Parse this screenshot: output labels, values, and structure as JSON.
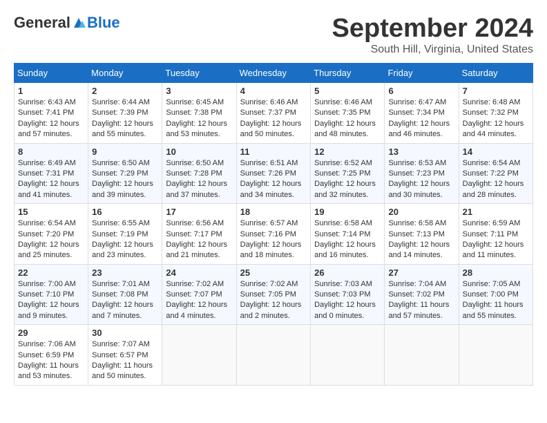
{
  "header": {
    "logo_general": "General",
    "logo_blue": "Blue",
    "month": "September 2024",
    "location": "South Hill, Virginia, United States"
  },
  "days_of_week": [
    "Sunday",
    "Monday",
    "Tuesday",
    "Wednesday",
    "Thursday",
    "Friday",
    "Saturday"
  ],
  "weeks": [
    [
      {
        "day": "1",
        "sunrise": "6:43 AM",
        "sunset": "7:41 PM",
        "daylight": "12 hours and 57 minutes."
      },
      {
        "day": "2",
        "sunrise": "6:44 AM",
        "sunset": "7:39 PM",
        "daylight": "12 hours and 55 minutes."
      },
      {
        "day": "3",
        "sunrise": "6:45 AM",
        "sunset": "7:38 PM",
        "daylight": "12 hours and 53 minutes."
      },
      {
        "day": "4",
        "sunrise": "6:46 AM",
        "sunset": "7:37 PM",
        "daylight": "12 hours and 50 minutes."
      },
      {
        "day": "5",
        "sunrise": "6:46 AM",
        "sunset": "7:35 PM",
        "daylight": "12 hours and 48 minutes."
      },
      {
        "day": "6",
        "sunrise": "6:47 AM",
        "sunset": "7:34 PM",
        "daylight": "12 hours and 46 minutes."
      },
      {
        "day": "7",
        "sunrise": "6:48 AM",
        "sunset": "7:32 PM",
        "daylight": "12 hours and 44 minutes."
      }
    ],
    [
      {
        "day": "8",
        "sunrise": "6:49 AM",
        "sunset": "7:31 PM",
        "daylight": "12 hours and 41 minutes."
      },
      {
        "day": "9",
        "sunrise": "6:50 AM",
        "sunset": "7:29 PM",
        "daylight": "12 hours and 39 minutes."
      },
      {
        "day": "10",
        "sunrise": "6:50 AM",
        "sunset": "7:28 PM",
        "daylight": "12 hours and 37 minutes."
      },
      {
        "day": "11",
        "sunrise": "6:51 AM",
        "sunset": "7:26 PM",
        "daylight": "12 hours and 34 minutes."
      },
      {
        "day": "12",
        "sunrise": "6:52 AM",
        "sunset": "7:25 PM",
        "daylight": "12 hours and 32 minutes."
      },
      {
        "day": "13",
        "sunrise": "6:53 AM",
        "sunset": "7:23 PM",
        "daylight": "12 hours and 30 minutes."
      },
      {
        "day": "14",
        "sunrise": "6:54 AM",
        "sunset": "7:22 PM",
        "daylight": "12 hours and 28 minutes."
      }
    ],
    [
      {
        "day": "15",
        "sunrise": "6:54 AM",
        "sunset": "7:20 PM",
        "daylight": "12 hours and 25 minutes."
      },
      {
        "day": "16",
        "sunrise": "6:55 AM",
        "sunset": "7:19 PM",
        "daylight": "12 hours and 23 minutes."
      },
      {
        "day": "17",
        "sunrise": "6:56 AM",
        "sunset": "7:17 PM",
        "daylight": "12 hours and 21 minutes."
      },
      {
        "day": "18",
        "sunrise": "6:57 AM",
        "sunset": "7:16 PM",
        "daylight": "12 hours and 18 minutes."
      },
      {
        "day": "19",
        "sunrise": "6:58 AM",
        "sunset": "7:14 PM",
        "daylight": "12 hours and 16 minutes."
      },
      {
        "day": "20",
        "sunrise": "6:58 AM",
        "sunset": "7:13 PM",
        "daylight": "12 hours and 14 minutes."
      },
      {
        "day": "21",
        "sunrise": "6:59 AM",
        "sunset": "7:11 PM",
        "daylight": "12 hours and 11 minutes."
      }
    ],
    [
      {
        "day": "22",
        "sunrise": "7:00 AM",
        "sunset": "7:10 PM",
        "daylight": "12 hours and 9 minutes."
      },
      {
        "day": "23",
        "sunrise": "7:01 AM",
        "sunset": "7:08 PM",
        "daylight": "12 hours and 7 minutes."
      },
      {
        "day": "24",
        "sunrise": "7:02 AM",
        "sunset": "7:07 PM",
        "daylight": "12 hours and 4 minutes."
      },
      {
        "day": "25",
        "sunrise": "7:02 AM",
        "sunset": "7:05 PM",
        "daylight": "12 hours and 2 minutes."
      },
      {
        "day": "26",
        "sunrise": "7:03 AM",
        "sunset": "7:03 PM",
        "daylight": "12 hours and 0 minutes."
      },
      {
        "day": "27",
        "sunrise": "7:04 AM",
        "sunset": "7:02 PM",
        "daylight": "11 hours and 57 minutes."
      },
      {
        "day": "28",
        "sunrise": "7:05 AM",
        "sunset": "7:00 PM",
        "daylight": "11 hours and 55 minutes."
      }
    ],
    [
      {
        "day": "29",
        "sunrise": "7:06 AM",
        "sunset": "6:59 PM",
        "daylight": "11 hours and 53 minutes."
      },
      {
        "day": "30",
        "sunrise": "7:07 AM",
        "sunset": "6:57 PM",
        "daylight": "11 hours and 50 minutes."
      },
      null,
      null,
      null,
      null,
      null
    ]
  ]
}
